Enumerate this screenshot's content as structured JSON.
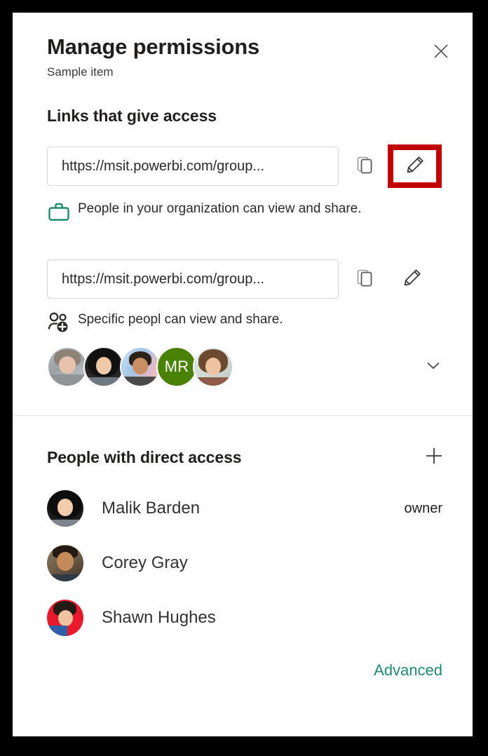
{
  "panel": {
    "title": "Manage permissions",
    "subtitle": "Sample item",
    "close_icon": "close-icon"
  },
  "links_section": {
    "heading": "Links that give access",
    "links": [
      {
        "url": "https://msit.powerbi.com/group...",
        "copy_icon": "copy-icon",
        "edit_icon": "pencil-icon",
        "highlighted": true,
        "scope_icon": "briefcase-icon",
        "scope_icon_color": "#1f8a6e",
        "description": "People in your organization can view and share."
      },
      {
        "url": "https://msit.powerbi.com/group...",
        "copy_icon": "copy-icon",
        "edit_icon": "pencil-icon",
        "highlighted": false,
        "scope_icon": "people-add-icon",
        "scope_icon_color": "#2b2a29",
        "description": "Specific peopl can view and share."
      }
    ],
    "avatars": [
      {
        "type": "photo",
        "style": "woman-gray"
      },
      {
        "type": "photo",
        "style": "woman-dark-hair"
      },
      {
        "type": "photo",
        "style": "man-glasses"
      },
      {
        "type": "initials",
        "initials": "MR",
        "color": "#498205"
      },
      {
        "type": "photo",
        "style": "woman-brown-hair"
      }
    ],
    "expand_icon": "chevron-down-icon"
  },
  "direct_access": {
    "heading": "People with direct access",
    "add_icon": "plus-icon",
    "people": [
      {
        "name": "Malik Barden",
        "role": "owner",
        "style": "woman-dark-hair"
      },
      {
        "name": "Corey Gray",
        "role": "",
        "style": "man-smiling"
      },
      {
        "name": "Shawn Hughes",
        "role": "",
        "style": "woman-red-bg"
      }
    ]
  },
  "footer": {
    "advanced_label": "Advanced",
    "advanced_color": "#1f8a6e"
  },
  "highlight": {
    "color": "#c20000"
  }
}
